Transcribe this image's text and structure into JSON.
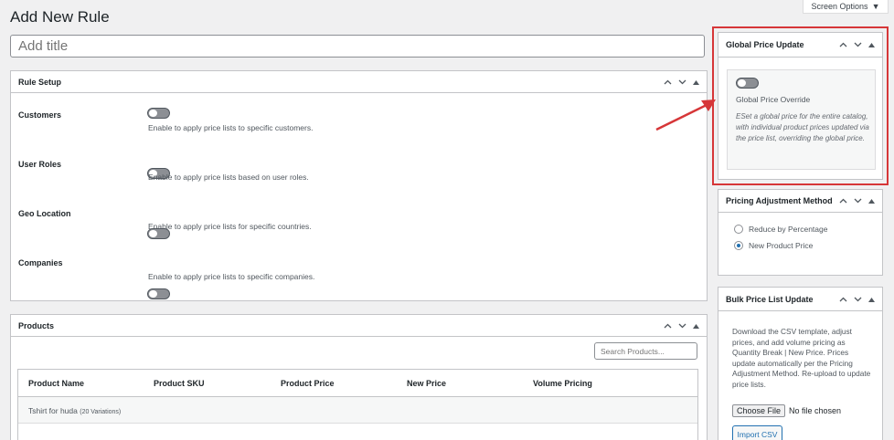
{
  "screen_options": {
    "label": "Screen Options",
    "icon": "caret-down-icon"
  },
  "page_title": "Add New Rule",
  "title_input": {
    "placeholder": "Add title",
    "value": ""
  },
  "rule_setup": {
    "title": "Rule Setup",
    "rows": [
      {
        "label": "Customers",
        "desc": "Enable to apply price lists to specific customers."
      },
      {
        "label": "User Roles",
        "desc": "Enable to apply price lists based on user roles."
      },
      {
        "label": "Geo Location",
        "desc": "Enable to apply price lists for specific countries."
      },
      {
        "label": "Companies",
        "desc": "Enable to apply price lists to specific companies."
      }
    ]
  },
  "products": {
    "title": "Products",
    "search_placeholder": "Search Products...",
    "columns": [
      "Product Name",
      "Product SKU",
      "Product Price",
      "New Price",
      "Volume Pricing"
    ],
    "row": {
      "name": "Tshirt for huda",
      "variations": "(20 Variations)"
    }
  },
  "global_price": {
    "title": "Global Price Update",
    "toggle_label": "Global Price Override",
    "desc": "ESet a global price for the entire catalog, with individual product prices updated via the price list, overriding the global price."
  },
  "pricing_method": {
    "title": "Pricing Adjustment Method",
    "options": [
      "Reduce by Percentage",
      "New Product Price"
    ],
    "selected": "New Product Price"
  },
  "bulk": {
    "title": "Bulk Price List Update",
    "desc": "Download the CSV template, adjust prices, and add volume pricing as Quantity Break | New Price. Prices update automatically per the Pricing Adjustment Method. Re-upload to update price lists.",
    "choose_file": "Choose File",
    "no_file": "No file chosen",
    "import": "Import CSV"
  },
  "colors": {
    "highlight": "#d63638",
    "accent": "#2271b1"
  }
}
